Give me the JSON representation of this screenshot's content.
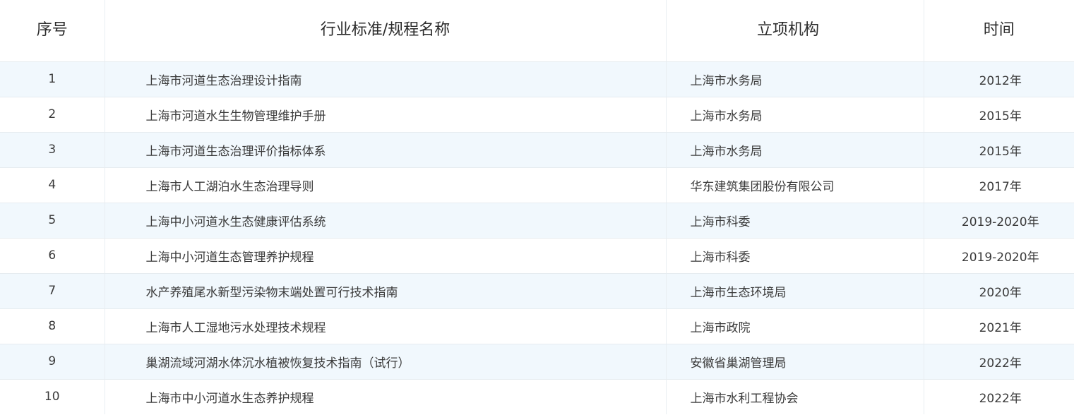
{
  "table": {
    "headers": {
      "index": "序号",
      "name": "行业标准/规程名称",
      "org": "立项机构",
      "time": "时间"
    },
    "rows": [
      {
        "index": "1",
        "name": "上海市河道生态治理设计指南",
        "org": "上海市水务局",
        "time": "2012年"
      },
      {
        "index": "2",
        "name": "上海市河道水生生物管理维护手册",
        "org": "上海市水务局",
        "time": "2015年"
      },
      {
        "index": "3",
        "name": "上海市河道生态治理评价指标体系",
        "org": "上海市水务局",
        "time": "2015年"
      },
      {
        "index": "4",
        "name": "上海市人工湖泊水生态治理导则",
        "org": "华东建筑集团股份有限公司",
        "time": "2017年"
      },
      {
        "index": "5",
        "name": "上海中小河道水生态健康评估系统",
        "org": "上海市科委",
        "time": "2019-2020年"
      },
      {
        "index": "6",
        "name": "上海中小河道生态管理养护规程",
        "org": "上海市科委",
        "time": "2019-2020年"
      },
      {
        "index": "7",
        "name": "水产养殖尾水新型污染物末端处置可行技术指南",
        "org": "上海市生态环境局",
        "time": "2020年"
      },
      {
        "index": "8",
        "name": "上海市人工湿地污水处理技术规程",
        "org": "上海市政院",
        "time": "2021年"
      },
      {
        "index": "9",
        "name": "巢湖流域河湖水体沉水植被恢复技术指南（试行）",
        "org": "安徽省巢湖管理局",
        "time": "2022年"
      },
      {
        "index": "10",
        "name": "上海市中小河道水生态养护规程",
        "org": "上海市水利工程协会",
        "time": "2022年"
      }
    ]
  },
  "colors": {
    "row_stripe": "#f1f8fd",
    "row_plain": "#ffffff",
    "border": "#e6ecf0",
    "text": "#3a3a3a"
  }
}
